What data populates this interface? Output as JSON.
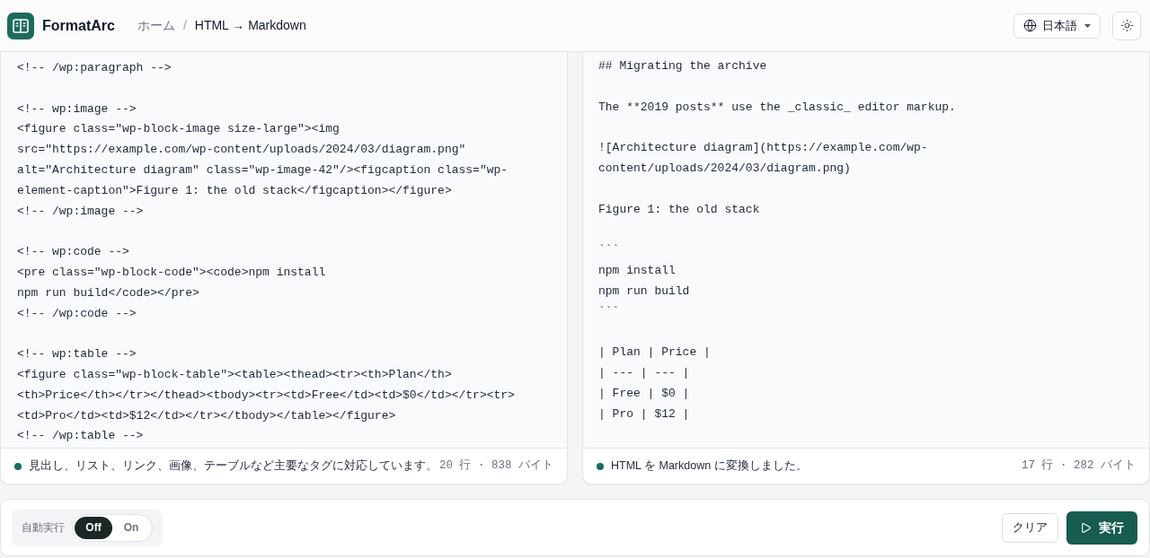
{
  "header": {
    "brand": "FormatArc",
    "breadcrumb": {
      "separator": "/",
      "items": [
        {
          "label": "ホーム",
          "current": false
        },
        {
          "label": "HTML → Markdown",
          "current": true
        }
      ]
    },
    "language": "日本語"
  },
  "panels": [
    {
      "blocks": [
        [
          "<!-- /wp:paragraph -->"
        ],
        [
          "<!-- wp:image -->",
          "<figure class=\"wp-block-image size-large\"><img",
          "src=\"https://example.com/wp-content/uploads/2024/03/diagram.png\"",
          "alt=\"Architecture diagram\" class=\"wp-image-42\"/><figcaption class=\"wp-",
          "element-caption\">Figure 1: the old stack</figcaption></figure>",
          "<!-- /wp:image -->"
        ],
        [
          "<!-- wp:code -->",
          "<pre class=\"wp-block-code\"><code>npm install",
          "npm run build</code></pre>",
          "<!-- /wp:code -->"
        ],
        [
          "<!-- wp:table -->",
          "<figure class=\"wp-block-table\"><table><thead><tr><th>Plan</th>",
          "<th>Price</th></tr></thead><tbody><tr><td>Free</td><td>$0</td></tr><tr>",
          "<td>Pro</td><td>$12</td></tr></tbody></table></figure>",
          "<!-- /wp:table -->"
        ]
      ],
      "status": "見出し、リスト、リンク、画像、テーブルなど主要なタグに対応しています。",
      "stats": "20 行 · 838 バイト"
    },
    {
      "blocks": [
        [
          "## Migrating the archive"
        ],
        [
          "The **2019 posts** use the _classic_ editor markup."
        ],
        [
          "![Architecture diagram](https://example.com/wp-",
          "content/uploads/2024/03/diagram.png)"
        ],
        [
          "Figure 1: the old stack"
        ],
        [
          "```",
          "npm install",
          "npm run build",
          "```"
        ],
        [
          "| Plan | Price |",
          "| --- | --- |",
          "| Free | $0 |",
          "| Pro | $12 |"
        ]
      ],
      "status": "HTML を Markdown に変換しました。",
      "stats": "17 行 · 282 バイト"
    }
  ],
  "controls": {
    "auto_run": {
      "label": "自動実行",
      "options": [
        {
          "label": "Off",
          "selected": true
        },
        {
          "label": "On",
          "selected": false
        }
      ]
    },
    "buttons": [
      {
        "label": "クリア",
        "kind": "outline"
      },
      {
        "label": "実行",
        "kind": "primary"
      }
    ]
  }
}
